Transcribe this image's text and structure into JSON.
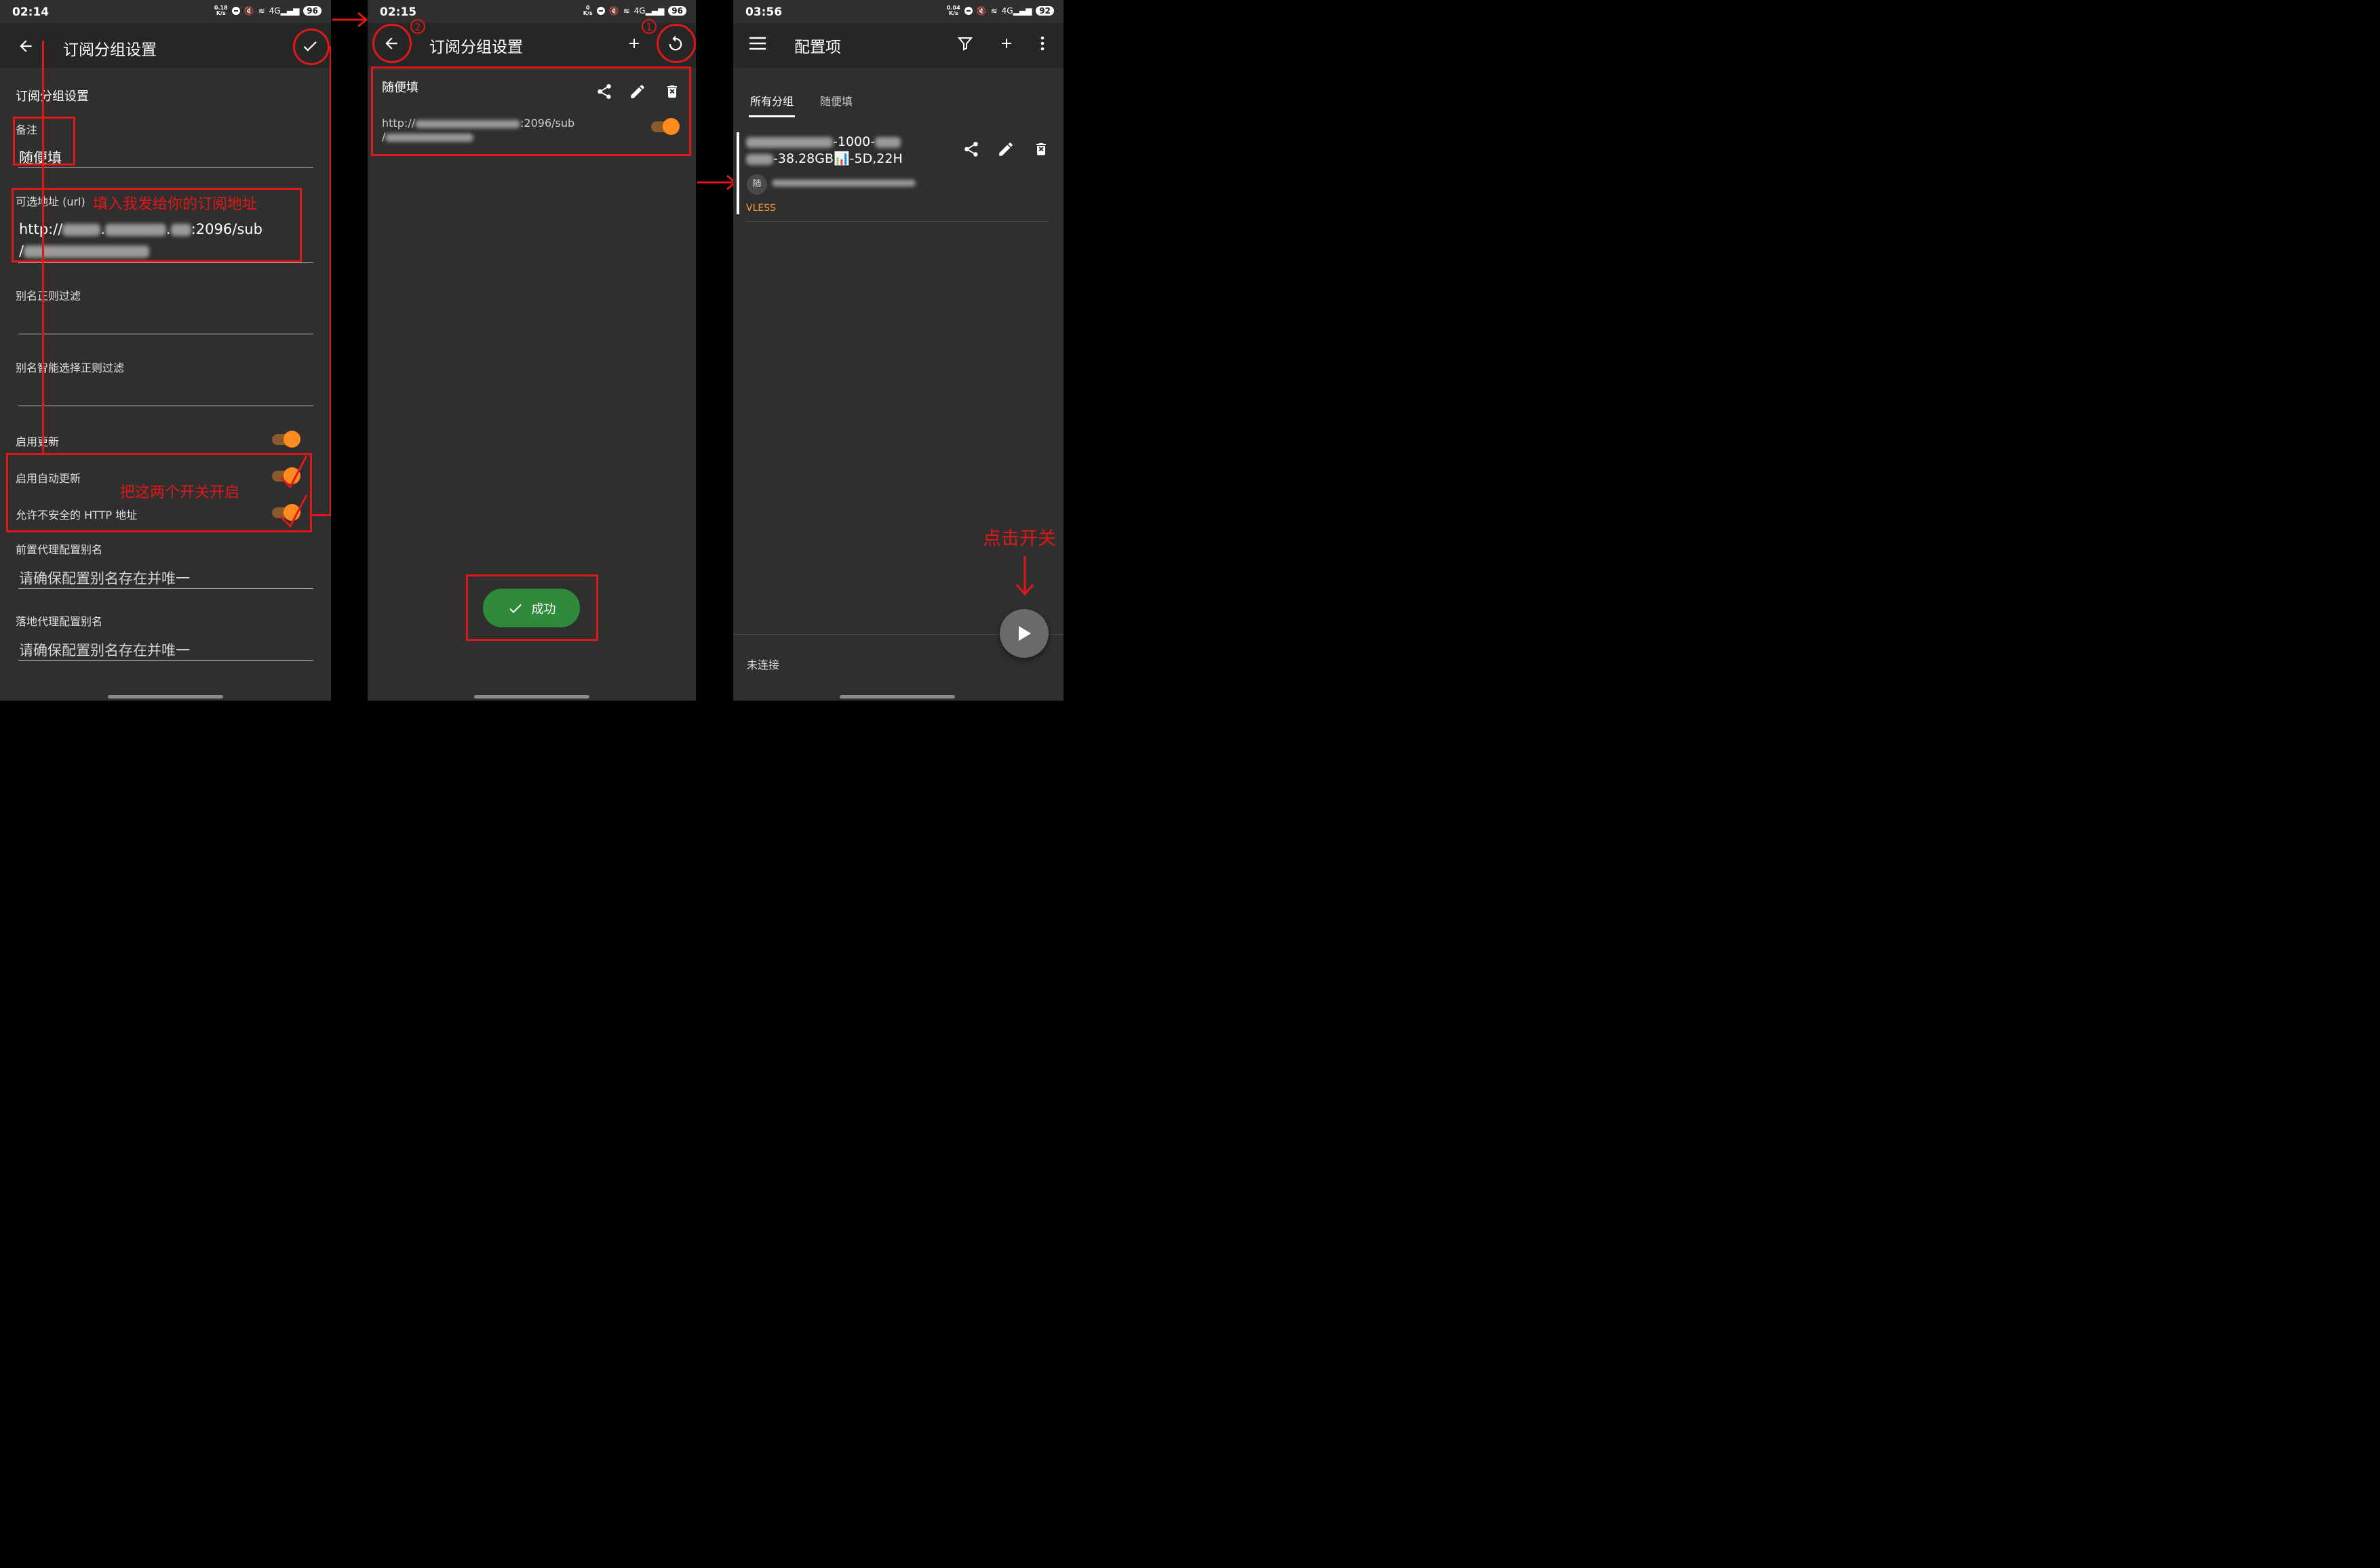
{
  "screen1": {
    "time": "02:14",
    "net_speed_top": "0.18",
    "net_speed_unit": "K/s",
    "net_type": "4G",
    "battery": "96",
    "title": "订阅分组设置",
    "section_title": "订阅分组设置",
    "remark_label": "备注",
    "remark_value": "随便填",
    "url_label": "可选地址 (url)",
    "url_hint": "填入我发给你的订阅地址",
    "url_line1_prefix": "http://",
    "url_line1_mid": ".",
    "url_line1_mid2": ".",
    "url_line1_suffix": ":2096/sub",
    "url_line2_prefix": "/",
    "alias_filter_label": "别名正则过滤",
    "alias_smart_label": "别名智能选择正则过滤",
    "enable_update_label": "启用更新",
    "auto_update_label": "启用自动更新",
    "allow_http_label": "允许不安全的 HTTP 地址",
    "switch_hint": "把这两个开关开启",
    "front_proxy_label": "前置代理配置别名",
    "front_proxy_placeholder": "请确保配置别名存在并唯一",
    "land_proxy_label": "落地代理配置别名",
    "land_proxy_placeholder": "请确保配置别名存在并唯一"
  },
  "screen2": {
    "time": "02:15",
    "net_speed_top": "0",
    "net_speed_unit": "K/s",
    "net_type": "4G",
    "battery": "96",
    "title": "订阅分组设置",
    "card_title": "随便填",
    "url_line1_prefix": "http://",
    "url_line1_suffix": ":2096/sub",
    "url_line2_prefix": "/",
    "num1": "1",
    "num2": "2",
    "toast": "成功"
  },
  "screen3": {
    "time": "03:56",
    "net_speed_top": "0.04",
    "net_speed_unit": "K/s",
    "net_type": "4G",
    "battery": "92",
    "title": "配置项",
    "tab_all": "所有分组",
    "tab_group": "随便填",
    "item_line1_suffix": "-1000-",
    "item_line2_suffix": "-38.28GB📊-5D,22H",
    "item_badge": "随",
    "item_protocol": "VLESS",
    "click_hint": "点击开关",
    "status": "未连接"
  },
  "colors": {
    "background": "#2f2f2f",
    "appbar": "#262626",
    "accent_orange": "#ff8a1e",
    "annotation_red": "#e01818",
    "success_green": "#2f8a3b",
    "protocol_orange": "#ff9a2e"
  }
}
